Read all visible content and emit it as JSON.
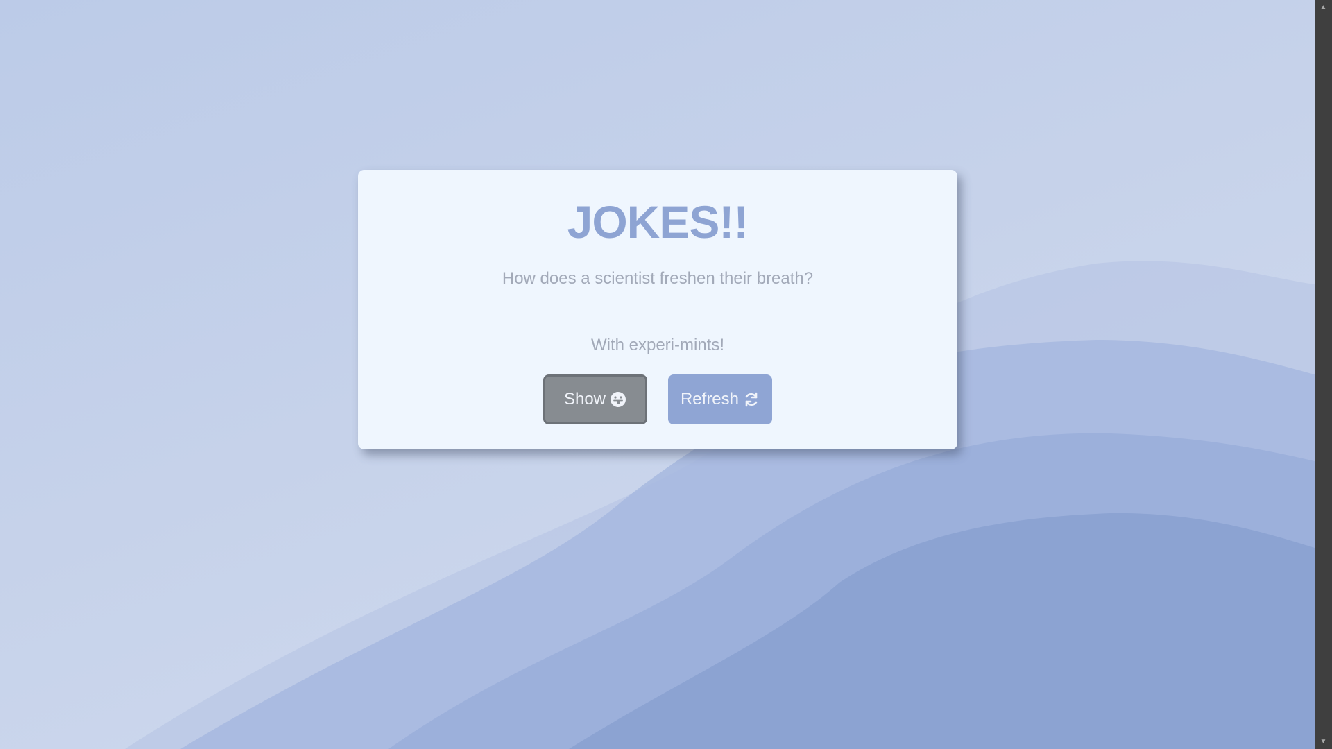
{
  "page": {
    "title": "JOKES!!"
  },
  "joke": {
    "question": "How does a scientist freshen their breath?",
    "answer": "With experi-mints!"
  },
  "buttons": {
    "show_label": "Show",
    "show_icon": "tongue-face-icon",
    "refresh_label": "Refresh",
    "refresh_icon": "refresh-icon"
  },
  "colors": {
    "title": "#8ea4d3",
    "card_background": "#eff6fe",
    "show_button": "#878c91",
    "refresh_button": "#8fa5d4",
    "text": "#a2a9b8"
  }
}
